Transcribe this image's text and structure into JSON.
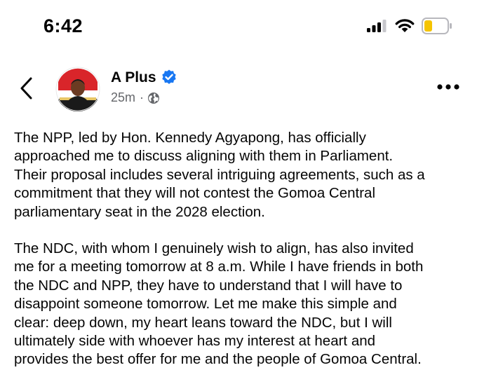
{
  "status_bar": {
    "time": "6:42",
    "icons": [
      "cellular-signal-icon",
      "wifi-icon",
      "battery-low-icon"
    ],
    "battery_color": "#f5c400"
  },
  "post": {
    "author": "A Plus",
    "verified": true,
    "time_ago": "25m",
    "meta_separator": "·",
    "audience_icon": "globe-icon",
    "accent_color": "#1877f2",
    "paragraphs": [
      "The NPP, led by Hon. Kennedy Agyapong, has officially\napproached me to discuss aligning with them in Parliament.\nTheir proposal includes several intriguing agreements, such as a\ncommitment that they will not contest the Gomoa Central\nparliamentary seat in the 2028 election.",
      "The NDC, with whom I genuinely wish to align, has also invited\nme for a meeting tomorrow at 8 a.m. While I have friends in both\nthe NDC and NPP, they have to understand that I will have to\ndisappoint someone tomorrow. Let me make this simple and\nclear: deep down, my heart leans toward the NDC, but I will\nultimately side with whoever has my interest at heart and\nprovides the best offer for me and the people of Gomoa Central."
    ]
  }
}
